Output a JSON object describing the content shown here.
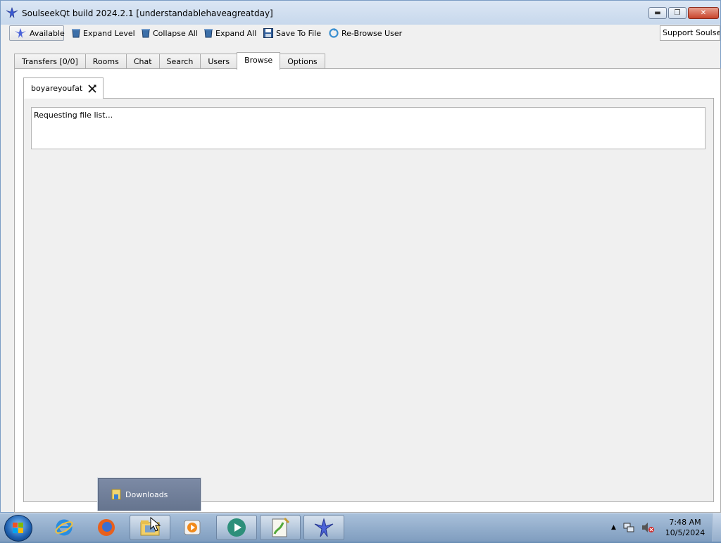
{
  "window": {
    "title": "SoulseekQt build 2024.2.1 [understandablehaveagreatday]",
    "buttons": {
      "minimize": "minimize",
      "maximize": "maximize",
      "close": "close"
    }
  },
  "toolbar": {
    "status_label": "Available",
    "expand_level": "Expand Level",
    "collapse_all": "Collapse All",
    "expand_all": "Expand All",
    "save_to_file": "Save To File",
    "rebrowse_user": "Re-Browse User",
    "support": "Support Soulseek"
  },
  "tabs": [
    {
      "label": "Transfers [0/0]",
      "active": false
    },
    {
      "label": "Rooms",
      "active": false
    },
    {
      "label": "Chat",
      "active": false
    },
    {
      "label": "Search",
      "active": false
    },
    {
      "label": "Users",
      "active": false
    },
    {
      "label": "Browse",
      "active": true
    },
    {
      "label": "Options",
      "active": false
    }
  ],
  "browse": {
    "user_tab": "boyareyoufat",
    "status_text": "Requesting file list..."
  },
  "jumplist": {
    "item": "Downloads"
  },
  "taskbar": {
    "apps": [
      "internet-explorer",
      "firefox",
      "file-explorer",
      "media-player",
      "media-center",
      "notepad-plus-plus",
      "soulseek"
    ],
    "time": "7:48 AM",
    "date": "10/5/2024"
  }
}
